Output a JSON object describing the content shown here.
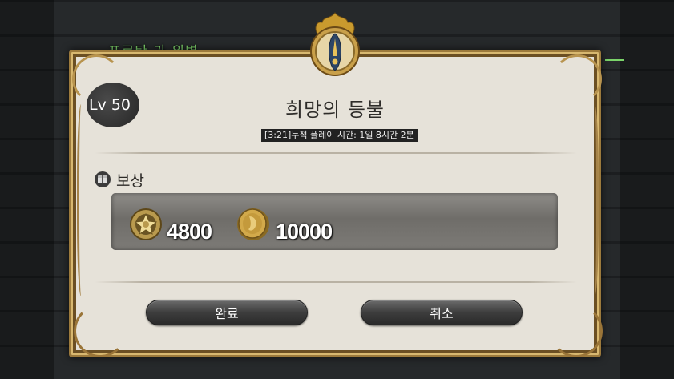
{
  "background": {
    "partial_text": "프로탄 가 위병"
  },
  "dialog": {
    "level": "Lv 50",
    "title": "희망의 등불",
    "playtime": "[3:21]누적 플레이 시간: 1일 8시간 2분",
    "reward_section_label": "보상",
    "rewards": [
      {
        "icon": "gil-coin-icon",
        "amount": "4800"
      },
      {
        "icon": "gold-coin-icon",
        "amount": "10000"
      }
    ],
    "buttons": {
      "complete": "완료",
      "cancel": "취소"
    }
  },
  "colors": {
    "frame_gold": "#9c7a3c",
    "panel": "#e6e2d9",
    "emblem_blue": "#2c4566"
  }
}
